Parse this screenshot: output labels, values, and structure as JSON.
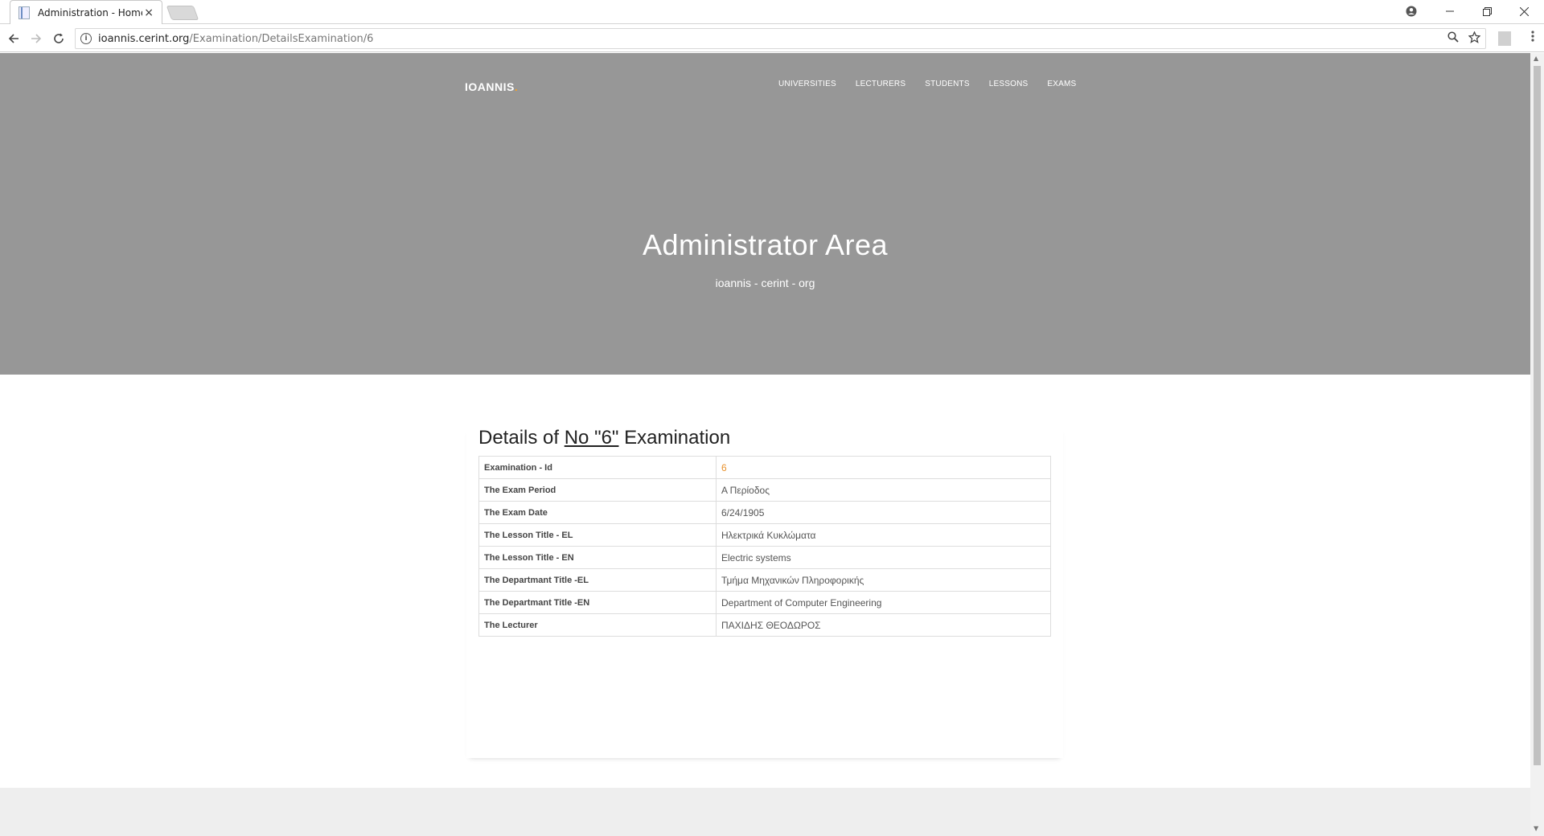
{
  "browser": {
    "tab_title": "Administration - Home - ",
    "tab_close": "×",
    "url_host": "ioannis.cerint.org",
    "url_path": "/Examination/DetailsExamination/6"
  },
  "site": {
    "brand": "IOANNIS",
    "brand_dot": ".",
    "nav": [
      "UNIVERSITIES",
      "LECTURERS",
      "STUDENTS",
      "LESSONS",
      "EXAMS"
    ],
    "hero_title": "Administrator Area",
    "hero_subtitle": "ioannis - cerint - org"
  },
  "details": {
    "title_prefix": "Details of ",
    "title_number": "No \"6\"",
    "title_suffix": " Examination",
    "rows": [
      {
        "label": "Examination - Id",
        "value": "6"
      },
      {
        "label": "The Exam Period",
        "value": "Α Περίοδος"
      },
      {
        "label": "The Exam Date",
        "value": "6/24/1905"
      },
      {
        "label": "The Lesson Title - EL",
        "value": "Ηλεκτρικά Κυκλώματα"
      },
      {
        "label": "The Lesson Title - EN",
        "value": "Electric systems"
      },
      {
        "label": "The Departmant Title -EL",
        "value": "Τμήμα Μηχανικών Πληροφορικής"
      },
      {
        "label": "The Departmant Title -EN",
        "value": "Department of Computer Engineering"
      },
      {
        "label": "The Lecturer",
        "value": "ΠΑΧΙΔΗΣ ΘΕΟΔΩΡΟΣ"
      }
    ]
  },
  "colors": {
    "hero_bg": "#979797",
    "accent": "#f0a02b",
    "id_value": "#e8912c",
    "footer_bg": "#eeeeee"
  }
}
